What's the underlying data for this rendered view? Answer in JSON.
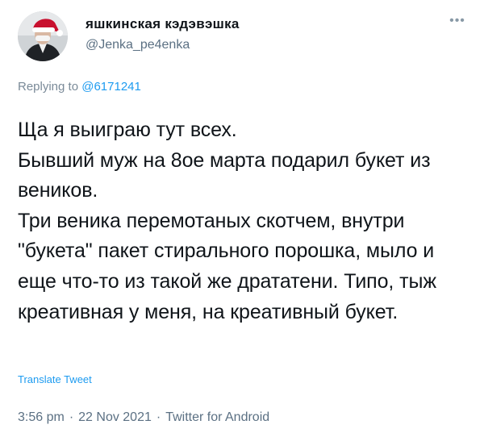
{
  "tweet": {
    "display_name": "яшкинская кэдэвэшка",
    "handle": "@Jenka_pe4enka",
    "more_icon": "more-dots-icon",
    "replying_prefix": "Replying to",
    "replying_to": "@6171241",
    "text": "Ща я выиграю тут всех.\nБывший муж на 8ое марта подарил букет из веников.\nТри веника перемотаных скотчем, внутри \"букета\" пакет стирального порошка, мыло и еще что-то из такой же дрататени. Типо, тыж креативная у меня, на креативный букет.",
    "translate_label": "Translate Tweet",
    "time": "3:56 pm",
    "date": "22 Nov 2021",
    "source": "Twitter for Android",
    "separator": "·"
  },
  "colors": {
    "text": "#0f1419",
    "secondary": "#5b7083",
    "link": "#1d9bf0",
    "santa_hat": "#c8102e"
  }
}
